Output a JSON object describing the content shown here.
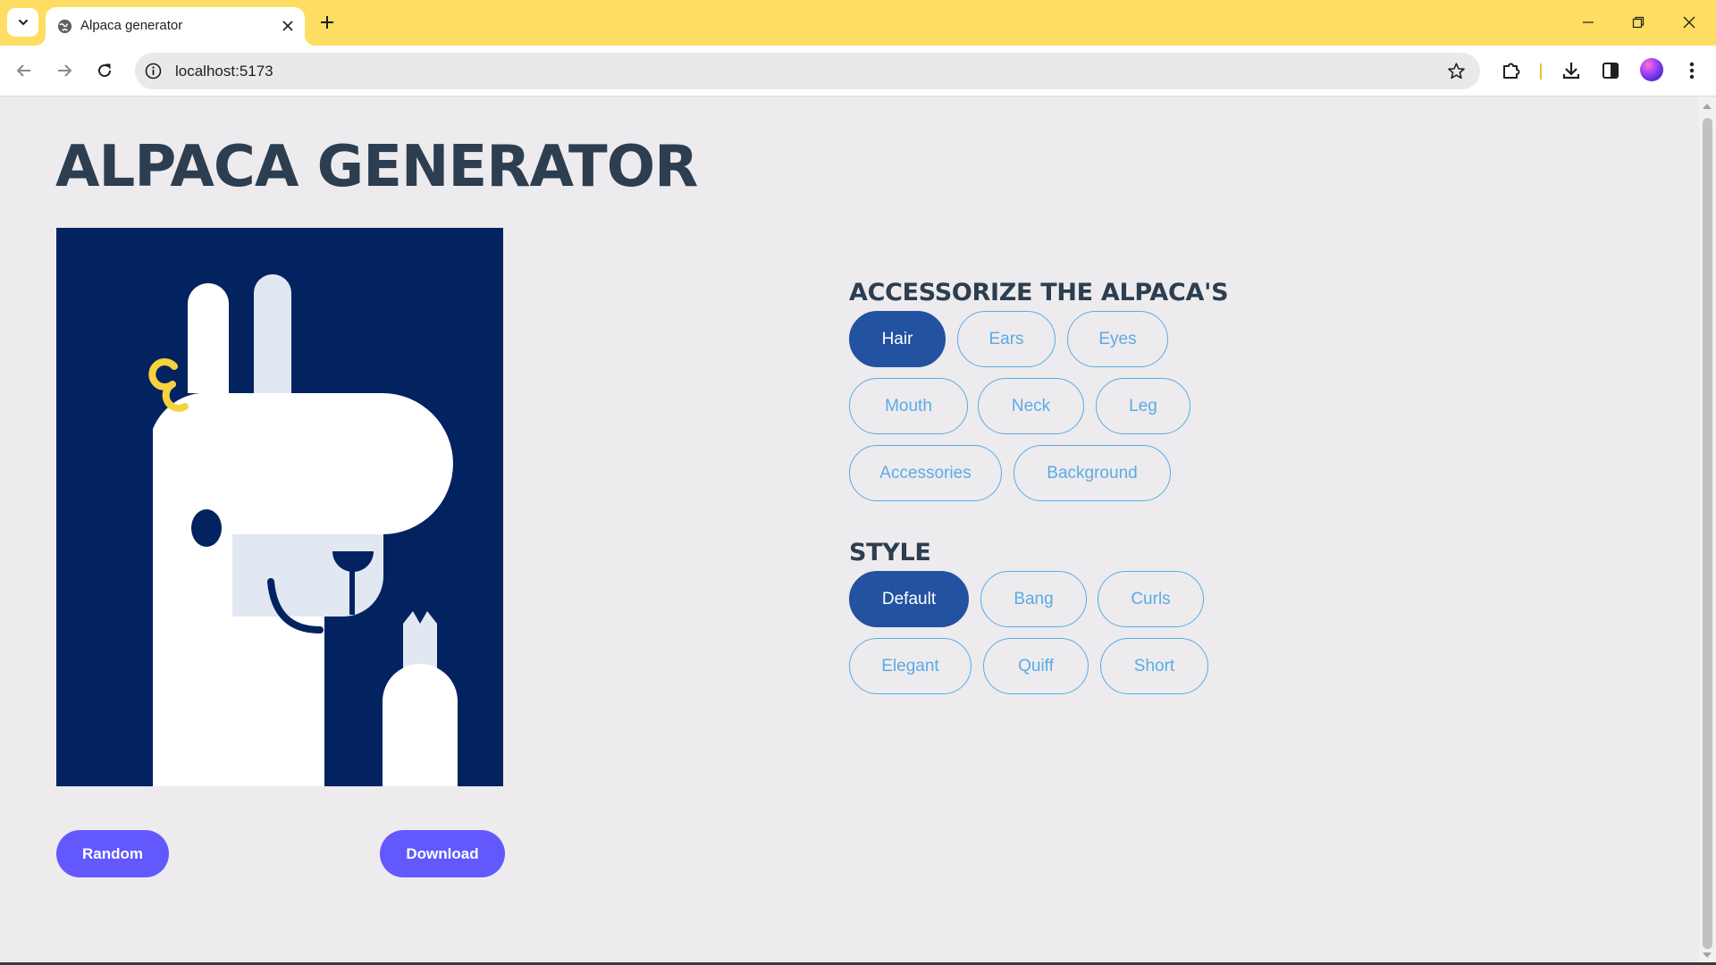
{
  "browser": {
    "tab_title": "Alpaca generator",
    "url": "localhost:5173"
  },
  "page": {
    "title": "ALPACA GENERATOR",
    "buttons": {
      "random": "Random",
      "download": "Download"
    }
  },
  "accessorize": {
    "heading": "ACCESSORIZE THE ALPACA'S",
    "items": [
      "Hair",
      "Ears",
      "Eyes",
      "Mouth",
      "Neck",
      "Leg",
      "Accessories",
      "Background"
    ],
    "selected": "Hair"
  },
  "style": {
    "heading": "STYLE",
    "items": [
      "Default",
      "Bang",
      "Curls",
      "Elegant",
      "Quiff",
      "Short"
    ],
    "selected": "Default"
  },
  "colors": {
    "chrome_tabbar": "#fdde62",
    "page_bg": "#edebee",
    "preview_bg": "#022360",
    "primary_button": "#6358fc",
    "pill_active": "#2252a0",
    "pill_outline": "#5aace4",
    "title_text": "#2c3e50"
  }
}
